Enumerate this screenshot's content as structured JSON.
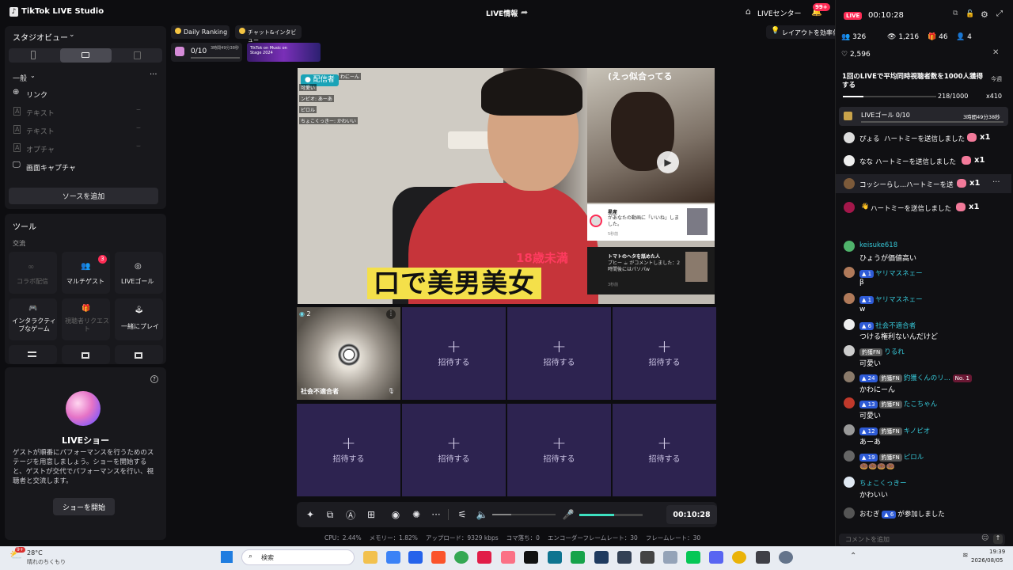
{
  "app": {
    "title": "TikTok LIVE Studio",
    "center_title": "LIVE情報",
    "live_center": "LIVEセンター",
    "notif_count": "99+"
  },
  "left": {
    "studio_view": "スタジオビュー",
    "general": "一般",
    "sources": [
      "リンク",
      "テキスト",
      "テキスト",
      "オプチャ",
      "画面キャプチャ"
    ],
    "add_source": "ソースを追加",
    "tools": "ツール",
    "interaction": "交流",
    "tools_items": [
      "コラボ配信",
      "マルチゲスト",
      "LIVEゴール",
      "インタラクティブなゲーム",
      "視聴者リクエスト",
      "一緒にプレイ"
    ],
    "multiguest_badge": "3",
    "liveshow_title": "LIVEショー",
    "liveshow_desc": "ゲストが順番にパフォーマンスを行うためのステージを用意しましょう。ショーを開始すると、ゲストが交代でパフォーマンスを行い、視聴者と交流します。",
    "start_show": "ショーを開始"
  },
  "top_chips": {
    "ranking": "Daily Ranking",
    "chat": "チャット&インタビュー",
    "progress": "0/10",
    "progress_time": "3時間49分38秒",
    "banner": "TikTok on Music on Stage 2024",
    "layout_tip": "レイアウトを効率化"
  },
  "stream": {
    "host_tag": "配信者",
    "overlay_caption": "口で美男美女",
    "age_text": "18歳未満",
    "speech": "(えっ似合ってる",
    "chat_lines": [
      "わにーん",
      "可愛い",
      "ンビオ: あーあ",
      "ピロル",
      "ちょこくっきー: かわいい"
    ],
    "notif1_user": "星産",
    "notif1_text": "があなたの動画に「いいね」しました。",
    "notif1_time": "5秒前",
    "notif2_user": "トマトのヘタを舐めた人",
    "notif2_text": "プヒー ☕ がコメントしました：2時間後にはパソパw",
    "notif2_time": "3秒前"
  },
  "guest": {
    "name": "社会不適合者",
    "count": "2",
    "invite": "招待する"
  },
  "controls": {
    "time": "00:10:28",
    "volume_level": 0.3,
    "mic_level": 0.55
  },
  "stats": {
    "cpu": "CPU：2.44%",
    "mem": "メモリー：1.82%",
    "upload": "アップロード：9329 kbps",
    "dropped": "コマ落ち：0",
    "enc": "エンコーダーフレームレート：30",
    "fps": "フレームレート：30"
  },
  "right": {
    "live_badge": "LIVE",
    "timer": "00:10:28",
    "viewers": "326",
    "likes": "1,216",
    "gifts": "46",
    "guests": "4",
    "hearts": "2,596",
    "goal_title": "1回のLIVEで平均同時視聴者数を1000人獲得する",
    "goal_date": "今週",
    "goal_progress": "218/1000",
    "goal_progress_fraction": 0.218,
    "goal_multiplier": "x410",
    "live_goal": "LIVEゴール 0/10",
    "live_goal_time": "3時間49分38秒",
    "hearts_events": [
      {
        "user": "ぴょる",
        "text": "ハートミーを送信しました",
        "mult": "x1"
      },
      {
        "user": "なな",
        "text": "ハートミーを送信しました",
        "mult": "x1"
      },
      {
        "user": "コッシーらし...",
        "text": "ハートミーを送信しました",
        "mult": "x1"
      },
      {
        "user": "",
        "text": "ハートミーを送信しました",
        "mult": "x1"
      }
    ],
    "comments": [
      {
        "user": "keisuke618",
        "text": "ひょうが価値高い"
      },
      {
        "user": "ヤリマスネェー",
        "text": "β",
        "lvl": "1"
      },
      {
        "user": "ヤリマスネェー",
        "text": "w",
        "lvl": "1"
      },
      {
        "user": "社会不適合者",
        "text": "つける権利ないんだけど",
        "lvl": "6"
      },
      {
        "user": "りるれ",
        "text": "可愛い",
        "tag": "釣獲FN"
      },
      {
        "user": "釣獲くんのリ...",
        "text": "かわにーん",
        "lvl": "24",
        "tag": "釣獲FN",
        "rank": "No. 1"
      },
      {
        "user": "たこちゃん",
        "text": "可愛い",
        "lvl": "13",
        "tag": "釣獲FN"
      },
      {
        "user": "キノピオ",
        "text": "あーあ",
        "lvl": "12",
        "tag": "釣獲FN"
      },
      {
        "user": "ピロル",
        "text": "🍩🍩🍩🍩",
        "lvl": "19",
        "tag": "釣獲FN"
      },
      {
        "user": "ちょこくっきー",
        "text": "かわいい"
      },
      {
        "user": "おむぎ",
        "text": "が参加しました",
        "lvl": "6"
      }
    ],
    "comment_placeholder": "コメントを追加"
  },
  "taskbar": {
    "temp": "28°C",
    "weather": "晴れのちくもり",
    "search": "検索",
    "time": "19:39",
    "date": "2026/08/05",
    "weather_badge": "9+"
  }
}
